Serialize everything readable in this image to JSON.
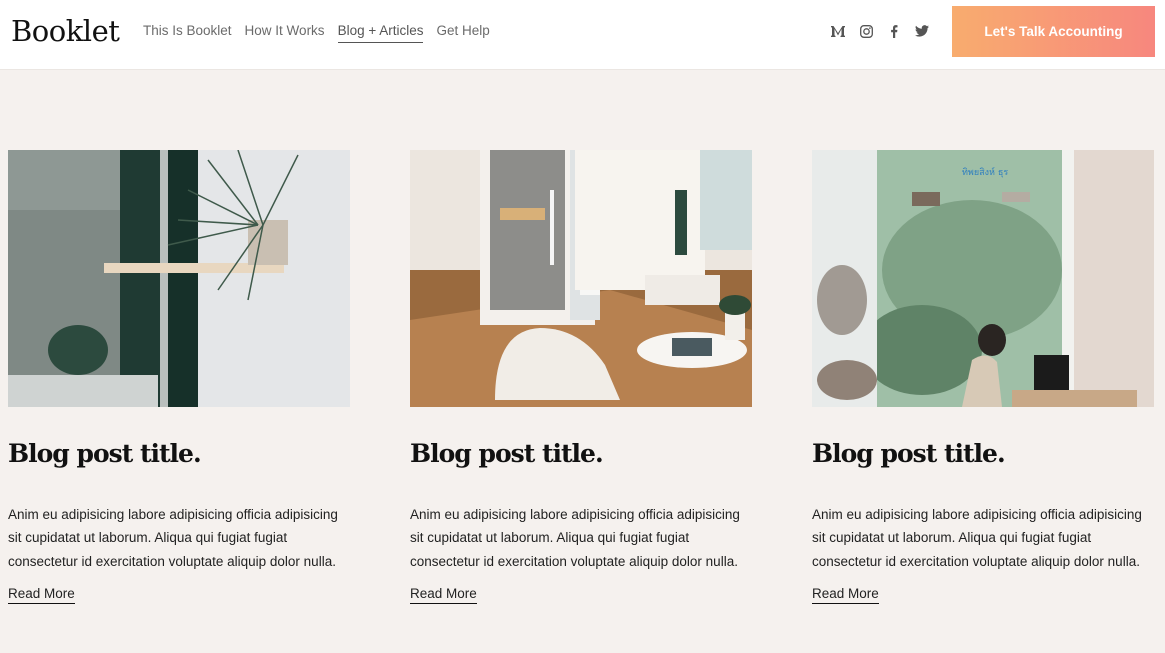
{
  "header": {
    "logo": "Booklet",
    "nav": [
      {
        "label": "This Is Booklet",
        "active": false
      },
      {
        "label": "How It Works",
        "active": false
      },
      {
        "label": "Blog + Articles",
        "active": true
      },
      {
        "label": "Get Help",
        "active": false
      }
    ],
    "social_icons": [
      "medium-icon",
      "instagram-icon",
      "facebook-icon",
      "twitter-icon"
    ],
    "cta_label": "Let's Talk Accounting",
    "cta_gradient": [
      "#f8ac6e",
      "#f7877e"
    ]
  },
  "posts": [
    {
      "image": "plant-on-shelf-photo",
      "title": "Blog post title.",
      "excerpt": "Anim eu adipisicing labore adipisicing officia adipisicing sit cupidatat ut laborum. Aliqua qui fugiat fugiat consectetur id exercitation voluptate aliquip dolor nulla.",
      "link": "Read More"
    },
    {
      "image": "office-phone-booth-photo",
      "title": "Blog post title.",
      "excerpt": "Anim eu adipisicing labore adipisicing officia adipisicing sit cupidatat ut laborum. Aliqua qui fugiat fugiat consectetur id exercitation voluptate aliquip dolor nulla.",
      "link": "Read More"
    },
    {
      "image": "woman-at-counter-photo",
      "title": "Blog post title.",
      "excerpt": "Anim eu adipisicing labore adipisicing officia adipisicing sit cupidatat ut laborum. Aliqua qui fugiat fugiat consectetur id exercitation voluptate aliquip dolor nulla.",
      "link": "Read More"
    }
  ]
}
